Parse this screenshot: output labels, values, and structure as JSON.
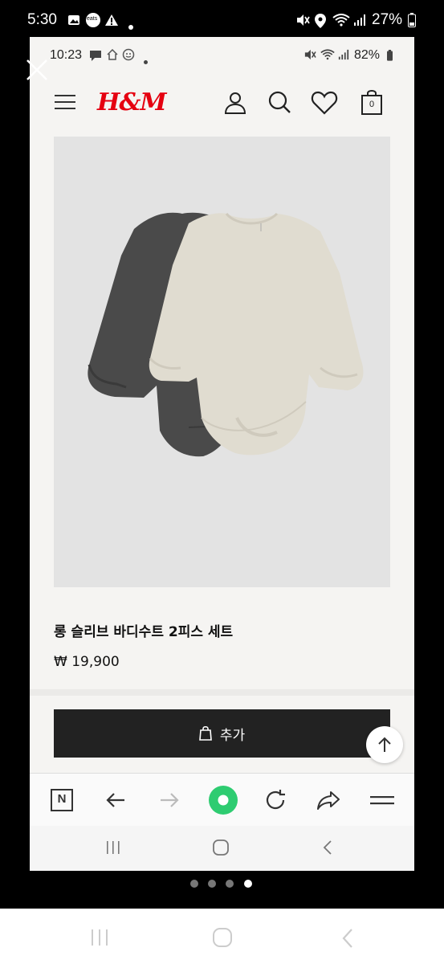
{
  "outer_status": {
    "time": "5:30",
    "battery": "27%",
    "icons": [
      "image-icon",
      "eats-app-icon",
      "warning-icon",
      "dot-icon",
      "mute-icon",
      "location-icon",
      "wifi-icon",
      "signal-icon",
      "battery-icon"
    ],
    "eats_label": "eats"
  },
  "inner_status": {
    "time": "10:23",
    "battery": "82%",
    "icons": [
      "chat-icon",
      "home-icon",
      "face-icon",
      "dot-icon",
      "mute-icon",
      "wifi-icon",
      "signal-icon",
      "battery-icon"
    ]
  },
  "header": {
    "logo": "H&M",
    "icons": [
      "menu-icon",
      "account-icon",
      "search-icon",
      "wishlist-icon",
      "cart-icon"
    ],
    "cart_count": "0"
  },
  "product": {
    "title": "롱 슬리브 바디수트 2피스 세트",
    "price": "₩ 19,900"
  },
  "add_to_cart": {
    "label": "추가"
  },
  "browser_bar": {
    "icons": [
      "naver-icon",
      "back-icon",
      "forward-icon",
      "home-green-icon",
      "reload-icon",
      "share-icon",
      "menu-icon"
    ],
    "naver_label": "N"
  },
  "page_indicator": {
    "total": 4,
    "active": 4
  },
  "colors": {
    "brand_red": "#e50010",
    "button_dark": "#222222",
    "accent_green": "#2ecc71"
  }
}
